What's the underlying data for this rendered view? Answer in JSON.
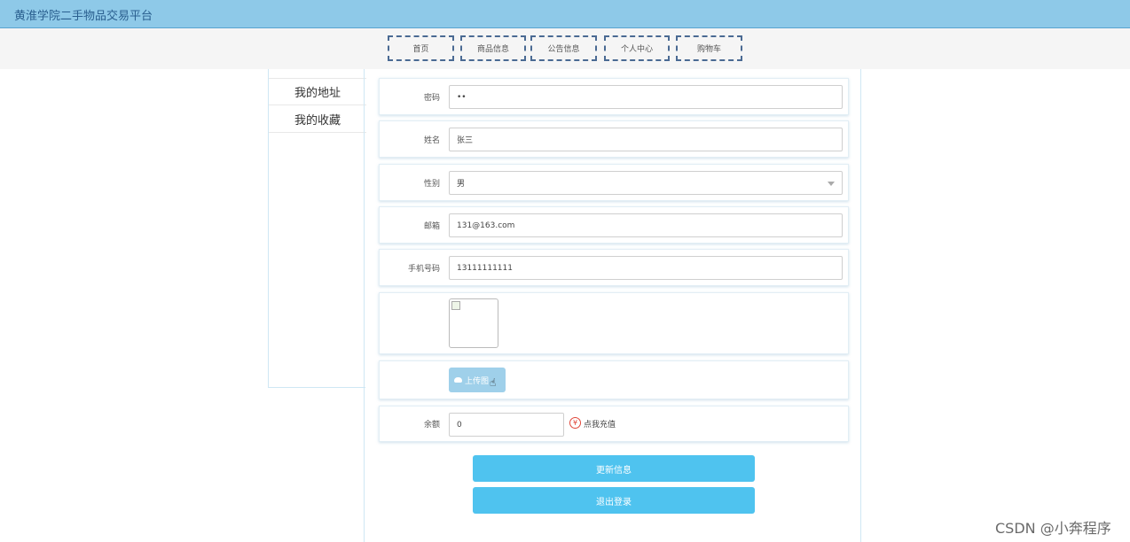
{
  "header": {
    "title": "黄淮学院二手物品交易平台"
  },
  "nav": {
    "home": "首页",
    "goods": "商品信息",
    "notice": "公告信息",
    "center": "个人中心",
    "cart": "购物车"
  },
  "sidebar": {
    "items": [
      "我的地址",
      "我的收藏"
    ]
  },
  "form": {
    "password": {
      "label": "密码",
      "value": "••"
    },
    "name": {
      "label": "姓名",
      "value": "张三"
    },
    "gender": {
      "label": "性别",
      "value": "男"
    },
    "email": {
      "label": "邮箱",
      "value": "131@163.com"
    },
    "phone": {
      "label": "手机号码",
      "value": "13111111111"
    },
    "upload_label": "上传图",
    "balance": {
      "label": "余额",
      "value": "0"
    },
    "recharge_text": "点我充值",
    "recharge_icon_text": "¥"
  },
  "buttons": {
    "update": "更新信息",
    "logout": "退出登录"
  },
  "watermark": "CSDN @小奔程序",
  "colors": {
    "accent": "#4fc3ef",
    "topbar": "#8ec9e8",
    "nav_border": "#4a6a93"
  },
  "icons": {
    "upload": "cloud-icon",
    "recharge": "yen-icon",
    "cursor": "hand-pointer-icon",
    "select": "chevron-down-icon"
  }
}
